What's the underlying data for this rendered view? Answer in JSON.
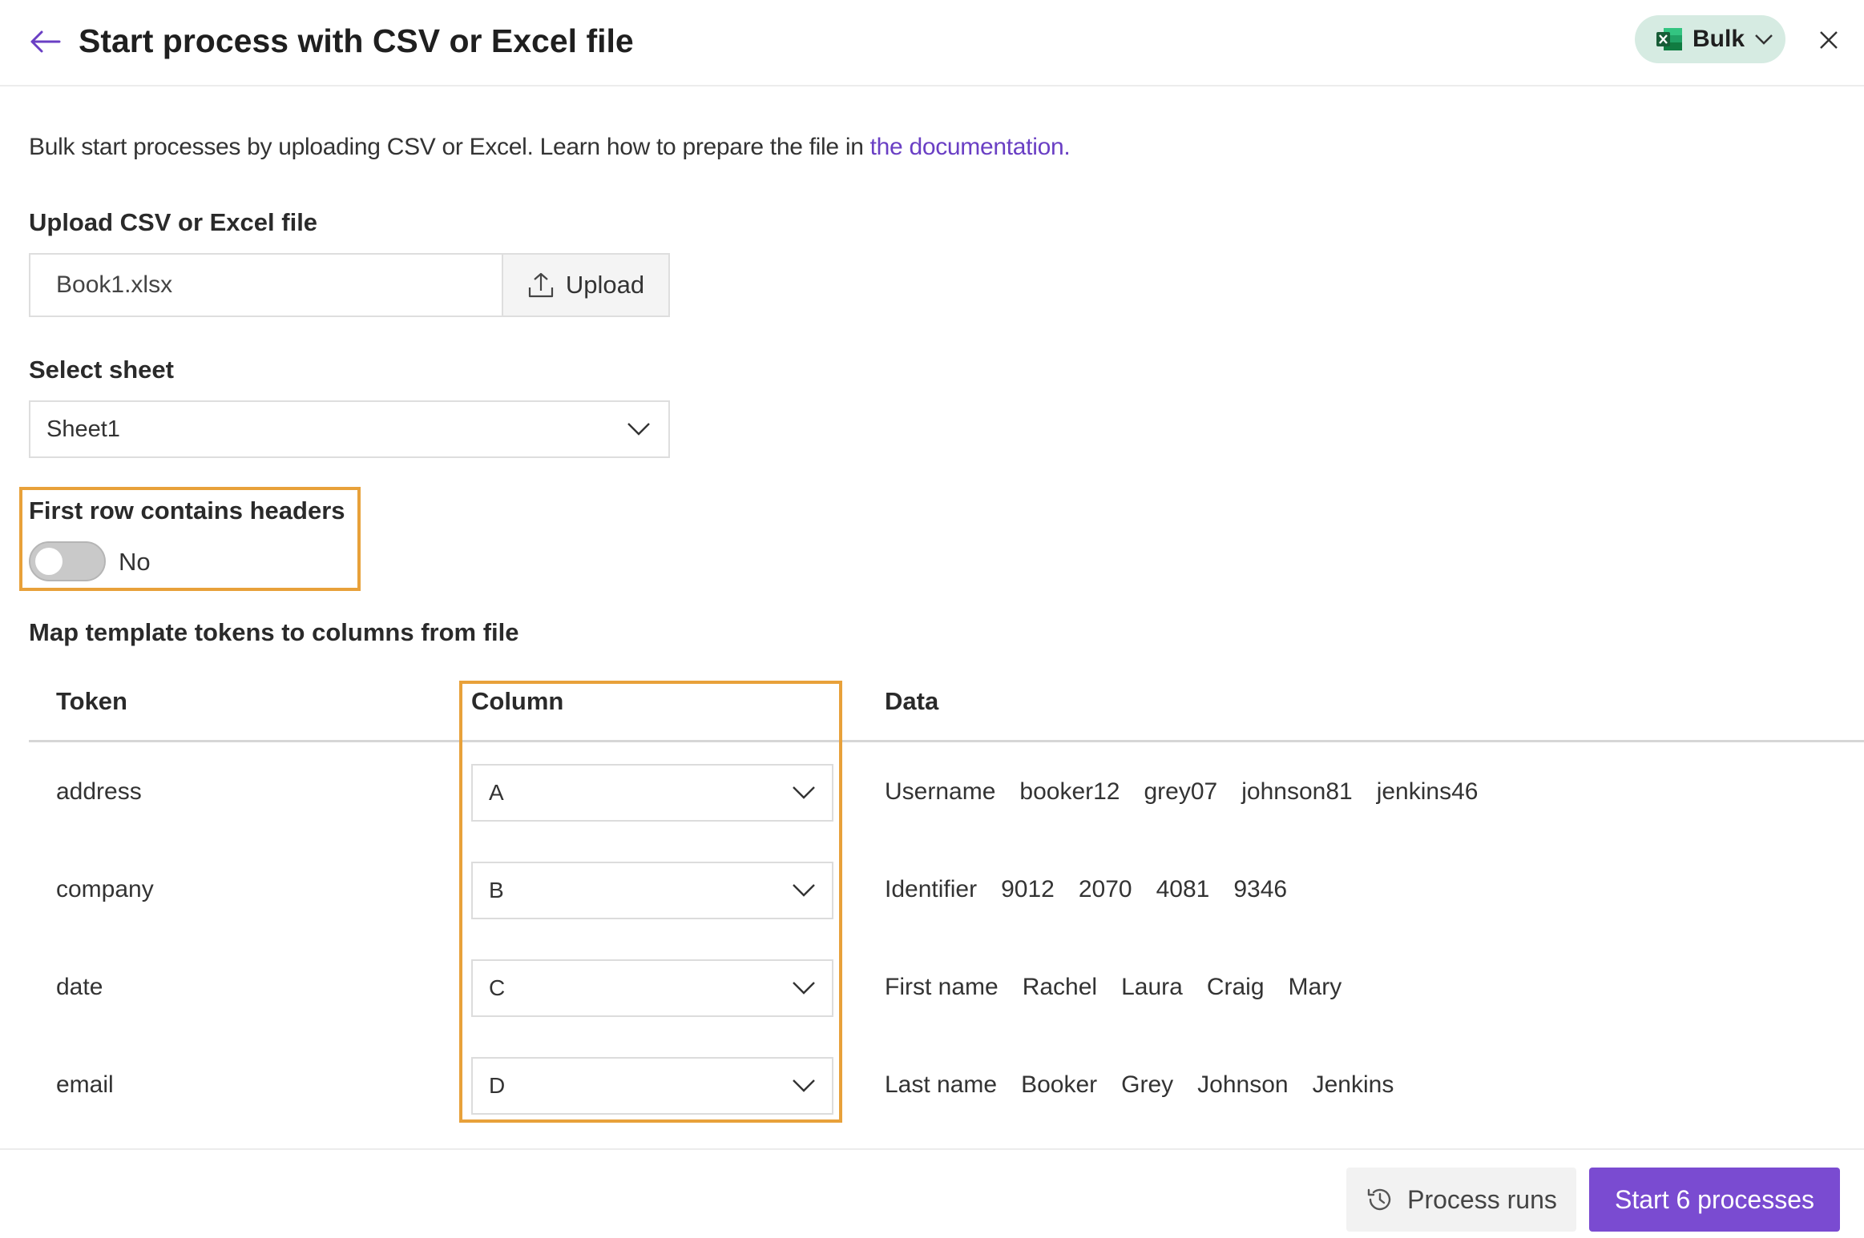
{
  "header": {
    "title": "Start process with CSV or Excel file",
    "mode_label": "Bulk",
    "back_icon": "arrow-left-icon",
    "close_icon": "close-icon",
    "excel_icon": "excel-icon"
  },
  "intro": {
    "text": "Bulk start processes by uploading CSV or Excel. Learn how to prepare the file in ",
    "link_text": "the documentation."
  },
  "upload": {
    "label": "Upload CSV or Excel file",
    "file_name": "Book1.xlsx",
    "button_label": "Upload"
  },
  "sheet": {
    "label": "Select sheet",
    "selected": "Sheet1"
  },
  "headers_toggle": {
    "label": "First row contains headers",
    "state_text": "No",
    "enabled": false
  },
  "mapping": {
    "label": "Map template tokens to columns from file",
    "columns": [
      "Token",
      "Column",
      "Data"
    ],
    "rows": [
      {
        "token": "address",
        "column": "A",
        "data": [
          "Username",
          "booker12",
          "grey07",
          "johnson81",
          "jenkins46"
        ]
      },
      {
        "token": "company",
        "column": "B",
        "data": [
          "Identifier",
          "9012",
          "2070",
          "4081",
          "9346"
        ]
      },
      {
        "token": "date",
        "column": "C",
        "data": [
          "First name",
          "Rachel",
          "Laura",
          "Craig",
          "Mary"
        ]
      },
      {
        "token": "email",
        "column": "D",
        "data": [
          "Last name",
          "Booker",
          "Grey",
          "Johnson",
          "Jenkins"
        ]
      }
    ]
  },
  "footer": {
    "process_runs_label": "Process runs",
    "start_label": "Start 6 processes"
  },
  "colors": {
    "accent": "#7a4bd1",
    "link": "#6a3fc4",
    "highlight": "#e8a13a",
    "bulk_pill_bg": "#d6ebe2"
  }
}
